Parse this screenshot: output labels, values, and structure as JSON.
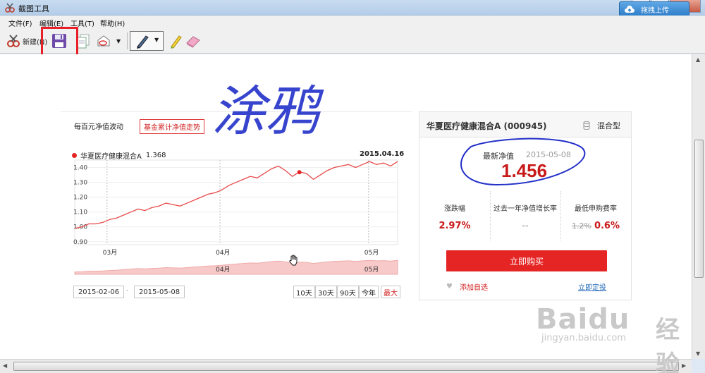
{
  "window": {
    "title": "截图工具"
  },
  "upload": {
    "label": "拖拽上传"
  },
  "menu": {
    "items": [
      "文件(F)",
      "编辑(E)",
      "工具(T)",
      "帮助(H)"
    ]
  },
  "toolbar": {
    "new_label": "新建(N)"
  },
  "annotation": {
    "scribble_text": "涂鸦"
  },
  "chart": {
    "tabs": [
      "每百元净值波动",
      "基金累计净值走势"
    ],
    "legend_name": "华夏医疗健康混合A",
    "legend_value": "1.368",
    "legend_date": "2015.04.16",
    "date_from": "2015-02-06",
    "date_sep": "-",
    "date_to": "2015-05-08",
    "ranges": [
      "10天",
      "30天",
      "90天",
      "今年",
      "最大"
    ]
  },
  "chart_data": {
    "type": "line",
    "title": "",
    "xlabel": "",
    "ylabel": "",
    "x_ticks": [
      "03月",
      "04月",
      "05月"
    ],
    "y_ticks": [
      "1.40",
      "1.30",
      "1.20",
      "1.10",
      "1.00",
      "0.90"
    ],
    "ylim": [
      0.88,
      1.45
    ],
    "navigator_ticks": [
      "04月",
      "05月"
    ],
    "series": [
      {
        "name": "华夏医疗健康混合A",
        "color": "#e84a4a",
        "values": [
          0.99,
          1.0,
          1.02,
          1.02,
          1.03,
          1.05,
          1.06,
          1.08,
          1.1,
          1.12,
          1.11,
          1.13,
          1.14,
          1.16,
          1.15,
          1.14,
          1.16,
          1.18,
          1.2,
          1.22,
          1.23,
          1.25,
          1.28,
          1.3,
          1.32,
          1.34,
          1.33,
          1.36,
          1.39,
          1.41,
          1.38,
          1.34,
          1.37,
          1.36,
          1.32,
          1.35,
          1.38,
          1.4,
          1.41,
          1.42,
          1.4,
          1.42,
          1.44,
          1.42,
          1.43,
          1.41,
          1.44
        ]
      }
    ],
    "highlight_point": {
      "x_index": 32,
      "value": 1.368
    }
  },
  "fund": {
    "name": "华夏医疗健康混合A (000945)",
    "type": "混合型",
    "nav_label": "最新净值",
    "nav_date": "2015-05-08",
    "nav_value": "1.456",
    "stats": [
      {
        "label": "涨跌幅",
        "value": "2.97%"
      },
      {
        "label": "过去一年净值增长率",
        "value": "--"
      },
      {
        "label": "最低申购费率",
        "old": "1.2%",
        "value": "0.6%"
      }
    ],
    "buy_label": "立即购买",
    "fav_label": "添加自选",
    "invest_label": "立即定投"
  },
  "watermark": {
    "main": "Baidu",
    "cn": "经验",
    "sub": "jingyan.baidu.com"
  },
  "colors": {
    "accent_red": "#e52424",
    "link_blue": "#2a6ebb",
    "ink_blue": "#2230c8"
  }
}
